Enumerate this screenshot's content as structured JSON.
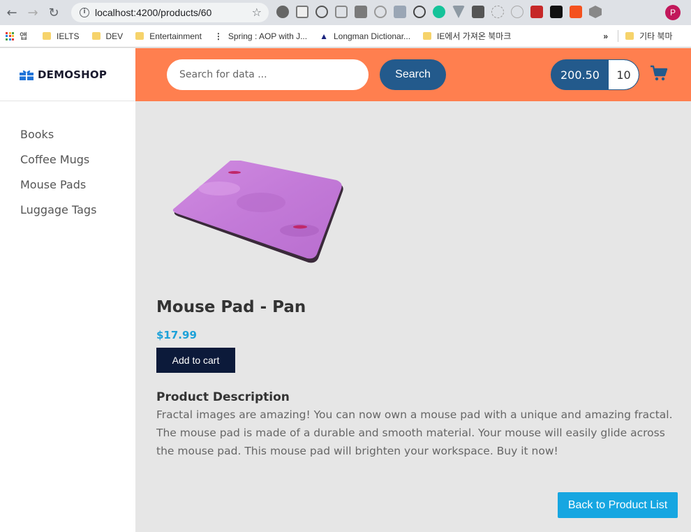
{
  "browser": {
    "url": "localhost:4200/products/60",
    "profile_initial": "P",
    "bookmarks": [
      {
        "label": "앱"
      },
      {
        "label": "IELTS"
      },
      {
        "label": "DEV"
      },
      {
        "label": "Entertainment"
      },
      {
        "label": "Spring : AOP with J..."
      },
      {
        "label": "Longman Dictionar..."
      },
      {
        "label": "IE에서 가져온 북마크"
      },
      {
        "label": "»"
      },
      {
        "label": "기타 북마"
      }
    ]
  },
  "brand": {
    "name": "DEMOSHOP"
  },
  "sidebar": {
    "categories": [
      "Books",
      "Coffee Mugs",
      "Mouse Pads",
      "Luggage Tags"
    ]
  },
  "header": {
    "search_placeholder": "Search for data ...",
    "search_label": "Search",
    "cart_total": "200.50",
    "cart_quantity": "10"
  },
  "product": {
    "name": "Mouse Pad - Pan",
    "price": "$17.99",
    "add_to_cart_label": "Add to cart",
    "description_heading": "Product Description",
    "description": "Fractal images are amazing! You can now own a mouse pad with a unique and amazing fractal. The mouse pad is made of a durable and smooth material. Your mouse will easily glide across the mouse pad. This mouse pad will brighten your workspace. Buy it now!",
    "back_label": "Back to Product List"
  },
  "colors": {
    "header_bg": "#ff7f4f",
    "primary": "#235a8c",
    "price": "#1da1d8",
    "add_to_cart_bg": "#0c1a3a",
    "back_btn_bg": "#16a6e1"
  }
}
